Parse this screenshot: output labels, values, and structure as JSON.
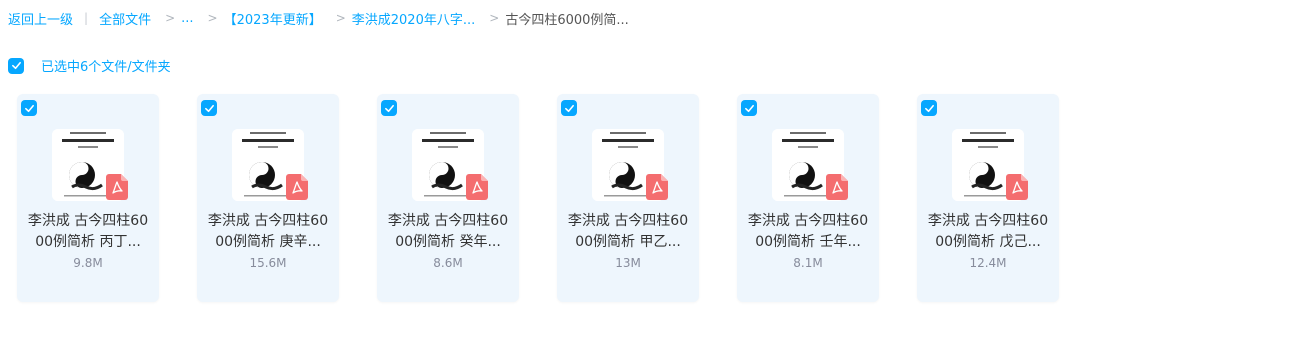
{
  "breadcrumb": {
    "back": "返回上一级",
    "all_files": "全部文件",
    "ellipsis": "...",
    "folder1": "【2023年更新】",
    "folder2": "李洪成2020年八字...",
    "current": "古今四柱6000例简..."
  },
  "selection": {
    "label": "已选中6个文件/文件夹",
    "checked": true
  },
  "colors": {
    "accent": "#06a7ff",
    "card_bg": "#eef6fd",
    "pdf_red": "#f46d6f"
  },
  "files": [
    {
      "name_line1": "李洪成 古今四柱60",
      "name_line2": "00例简析 丙丁...",
      "size": "9.8M",
      "icon": "pdf-icon"
    },
    {
      "name_line1": "李洪成 古今四柱60",
      "name_line2": "00例简析 庚辛...",
      "size": "15.6M",
      "icon": "pdf-icon"
    },
    {
      "name_line1": "李洪成 古今四柱60",
      "name_line2": "00例简析 癸年...",
      "size": "8.6M",
      "icon": "pdf-icon"
    },
    {
      "name_line1": "李洪成 古今四柱60",
      "name_line2": "00例简析 甲乙...",
      "size": "13M",
      "icon": "pdf-icon"
    },
    {
      "name_line1": "李洪成 古今四柱60",
      "name_line2": "00例简析 壬年...",
      "size": "8.1M",
      "icon": "pdf-icon"
    },
    {
      "name_line1": "李洪成 古今四柱60",
      "name_line2": "00例简析 戊己...",
      "size": "12.4M",
      "icon": "pdf-icon"
    }
  ]
}
